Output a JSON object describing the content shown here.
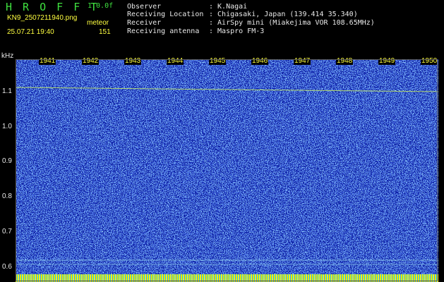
{
  "header": {
    "title": "H R O F F T",
    "version": "1.0.0f",
    "filename": "KN9_2507211940.png",
    "meteor_label": "meteor",
    "datetime": "25.07.21 19:40",
    "count": "151",
    "info": [
      {
        "label": "Observer",
        "value": ": K.Nagai"
      },
      {
        "label": "Receiving Location",
        "value": ": Chigasaki, Japan (139.414 35.340)"
      },
      {
        "label": "Receiver",
        "value": ": AirSpy mini (Miakejima VOR 108.65MHz)"
      },
      {
        "label": "Receiving antenna",
        "value": ": Maspro FM-3"
      }
    ]
  },
  "axis": {
    "unit": "kHz",
    "y_ticks": [
      "1.1",
      "1.0",
      "0.9",
      "0.8",
      "0.7",
      "0.6"
    ],
    "time_ticks": [
      "1941",
      "1942",
      "1943",
      "1944",
      "1945",
      "1946",
      "1947",
      "1948",
      "1949",
      "1950"
    ]
  },
  "colors": {
    "title": "#3fe03f",
    "label": "#ffff40",
    "text": "#e8e8e8",
    "background": "#0a1aa0"
  }
}
